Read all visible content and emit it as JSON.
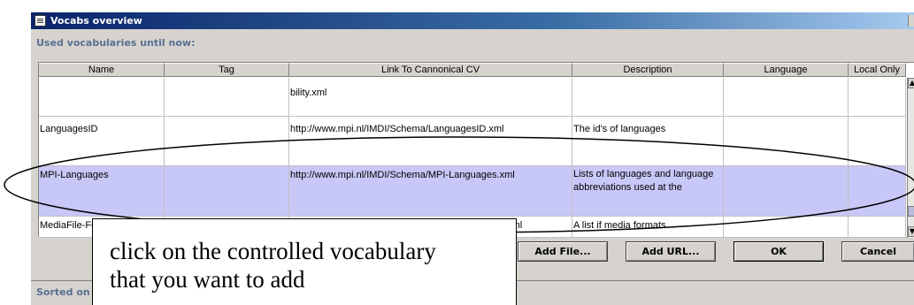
{
  "window": {
    "title": "Vocabs overview"
  },
  "section_label": "Used vocabularies until now:",
  "table": {
    "columns": [
      "Name",
      "Tag",
      "Link To Cannonical CV",
      "Description",
      "Language",
      "Local Only"
    ],
    "rows": [
      {
        "name": "",
        "tag": "",
        "link": "bility.xml",
        "description": "",
        "language": "",
        "local_only": "",
        "selected": false
      },
      {
        "name": "LanguagesID",
        "tag": "",
        "link": "http://www.mpi.nl/IMDI/Schema/LanguagesID.xml",
        "description": "The id's of languages",
        "language": "",
        "local_only": "",
        "selected": false
      },
      {
        "name": "MPI-Languages",
        "tag": "",
        "link": "http://www.mpi.nl/IMDI/Schema/MPI-Languages.xml",
        "description": "Lists of languages and language abbreviations used at the",
        "language": "",
        "local_only": "",
        "selected": true
      },
      {
        "name": "MediaFile-Format",
        "tag": "",
        "link": "http://www.mpi.nl/IMDI/Schema/MediaFile-Format.xml",
        "description": "A list if media formats",
        "language": "",
        "local_only": "",
        "selected": false
      }
    ]
  },
  "buttons": {
    "add_file": "Add File...",
    "add_url": "Add URL...",
    "ok": "OK",
    "cancel": "Cancel"
  },
  "status": "Sorted on c",
  "callout": {
    "line1": "click on the controlled vocabulary",
    "line2": "that you want to add"
  },
  "colors": {
    "title_bar": "#0a246a",
    "selection": "#c8c8f8",
    "label_text": "#5a6f94",
    "dialog_bg": "#d6d3ce"
  }
}
